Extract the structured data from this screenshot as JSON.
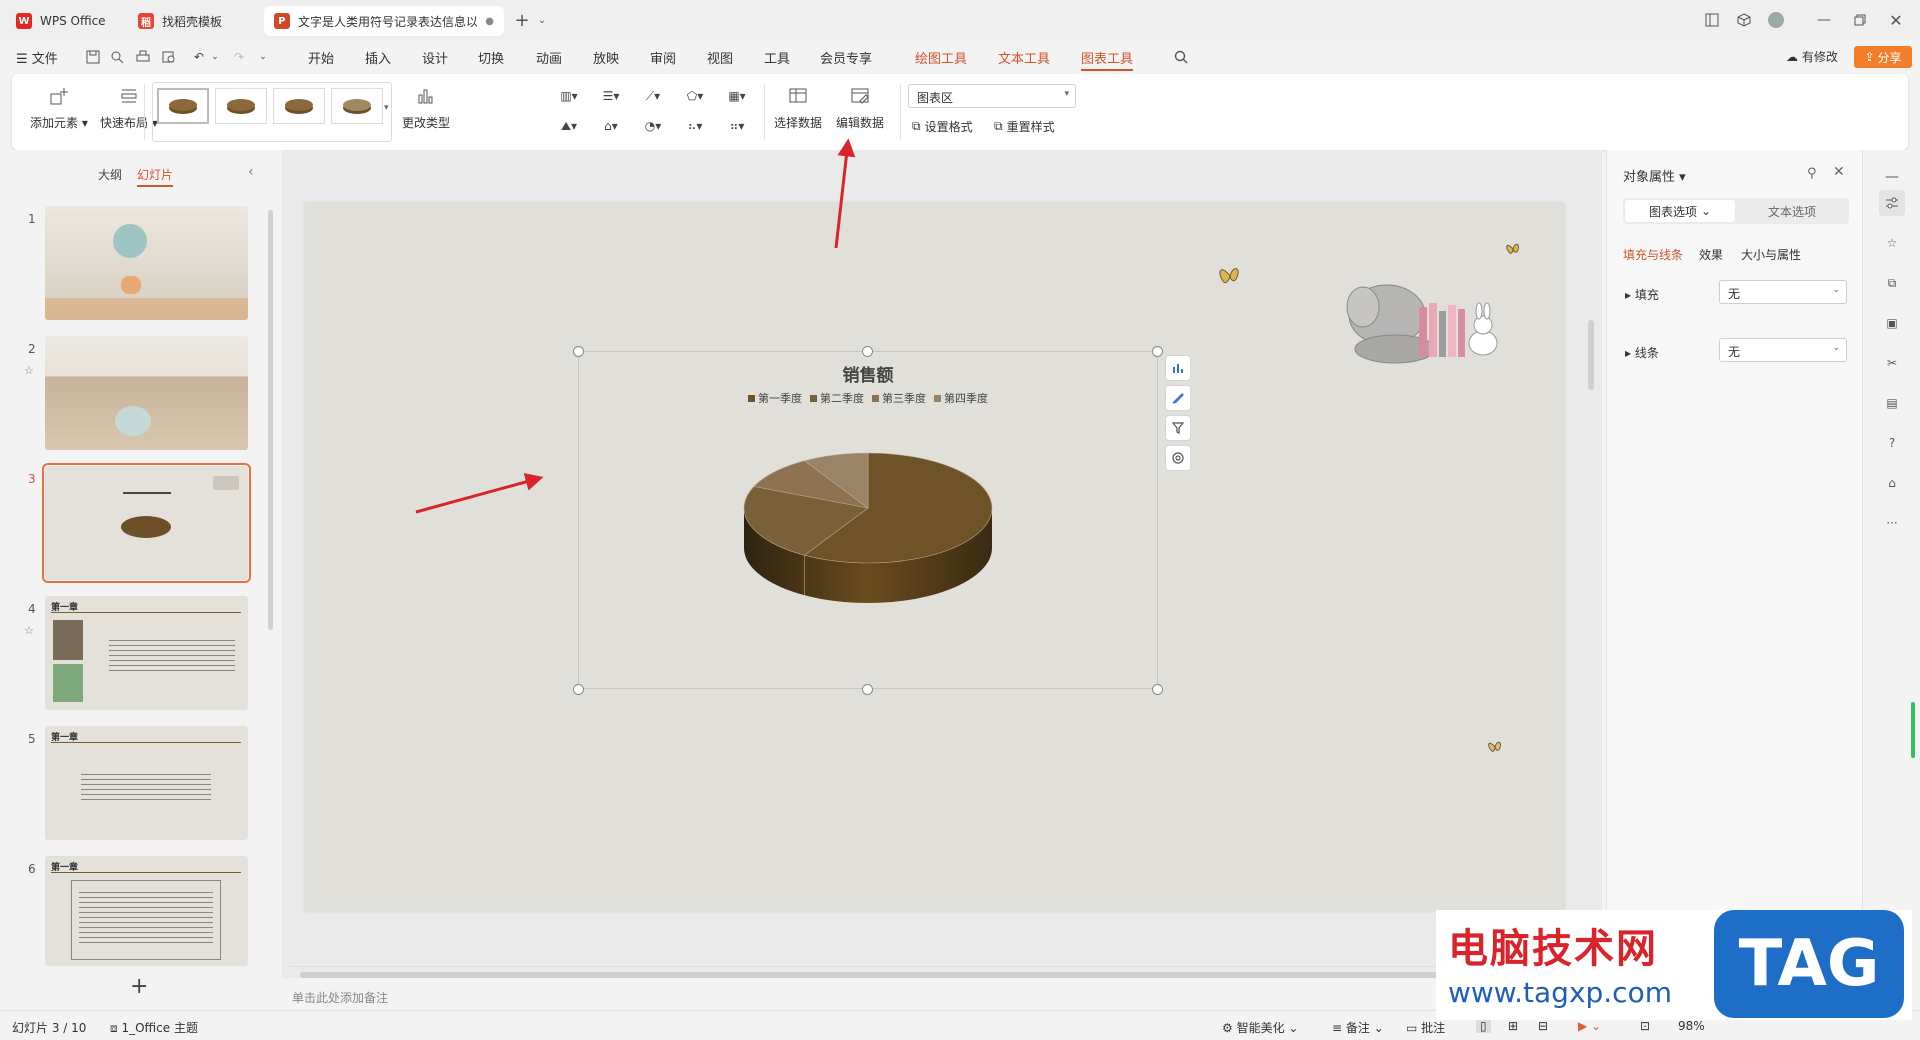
{
  "tabs": [
    {
      "label": "WPS Office"
    },
    {
      "label": "找稻壳模板"
    },
    {
      "label": "文字是人类用符号记录表达信息以"
    }
  ],
  "menu": {
    "file": "文件",
    "items": [
      "开始",
      "插入",
      "设计",
      "切换",
      "动画",
      "放映",
      "审阅",
      "视图",
      "工具",
      "会员专享"
    ],
    "tools": [
      "绘图工具",
      "文本工具",
      "图表工具"
    ],
    "right_modified": "有修改",
    "share": "分享"
  },
  "ribbon": {
    "add_element": "添加元素",
    "quick_layout": "快速布局",
    "change_type": "更改类型",
    "select_data": "选择数据",
    "edit_data": "编辑数据",
    "chart_area": "图表区",
    "set_format": "设置格式",
    "reset_style": "重置样式"
  },
  "left_panel": {
    "outline": "大纲",
    "slides": "幻灯片",
    "thumbs": [
      {
        "num": "1"
      },
      {
        "num": "2"
      },
      {
        "num": "3"
      },
      {
        "num": "4",
        "title": "第一章"
      },
      {
        "num": "5",
        "title": "第一章"
      },
      {
        "num": "6",
        "title": "第一章"
      }
    ],
    "add": "+"
  },
  "slide": {
    "chart_title": "销售额"
  },
  "chart_data": {
    "type": "pie",
    "title": "销售额",
    "categories": [
      "第一季度",
      "第二季度",
      "第三季度",
      "第四季度"
    ],
    "values": [
      8.2,
      3.2,
      1.4,
      1.2
    ],
    "colors": [
      "#6e5228",
      "#7a6038",
      "#8c7250",
      "#9a8468"
    ],
    "legend": "top"
  },
  "notes_placeholder": "单击此处添加备注",
  "right_panel": {
    "title": "对象属性",
    "tab_chart": "图表选项",
    "tab_text": "文本选项",
    "sub_fill_line": "填充与线条",
    "sub_effect": "效果",
    "sub_size": "大小与属性",
    "fill_label": "填充",
    "fill_value": "无",
    "line_label": "线条",
    "line_value": "无"
  },
  "status": {
    "slide_pos": "幻灯片 3 / 10",
    "theme": "1_Office 主题",
    "beautify": "智能美化",
    "notes": "备注",
    "comments": "批注",
    "zoom": "98%"
  },
  "watermark": {
    "site_cn": "电脑技术网",
    "url": "www.tagxp.com",
    "tag": "TAG"
  }
}
